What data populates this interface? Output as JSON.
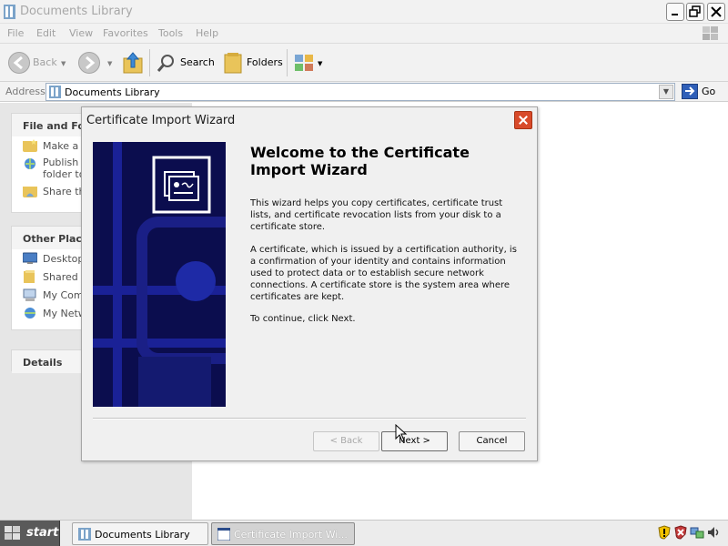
{
  "explorer": {
    "title": "Documents Library",
    "menu": [
      "File",
      "Edit",
      "View",
      "Favorites",
      "Tools",
      "Help"
    ],
    "toolbar": {
      "back": "Back",
      "search": "Search",
      "folders": "Folders"
    },
    "address": {
      "label": "Address",
      "value": "Documents Library",
      "go": "Go"
    },
    "sidebar": {
      "file_tasks": {
        "header": "File and Folder Tasks",
        "items": [
          "Make a new folder",
          "Publish this folder to the Web",
          "Share this folder"
        ]
      },
      "other_places": {
        "header": "Other Places",
        "items": [
          "Desktop",
          "Shared Documents",
          "My Computer",
          "My Network Places"
        ]
      },
      "details": {
        "header": "Details"
      }
    }
  },
  "dialog": {
    "title": "Certificate Import Wizard",
    "heading": "Welcome to the Certificate Import Wizard",
    "paragraphs": [
      "This wizard helps you copy certificates, certificate trust lists, and certificate revocation lists from your disk to a certificate store.",
      "A certificate, which is issued by a certification authority, is a confirmation of your identity and contains information used to protect data or to establish secure network connections. A certificate store is the system area where certificates are kept.",
      "To continue, click Next."
    ],
    "buttons": {
      "back": "< Back",
      "next": "Next >",
      "cancel": "Cancel"
    },
    "banner_color": "#0b0d4e",
    "close_color": "#d84a2a"
  },
  "taskbar": {
    "start": "start",
    "tasks": [
      "Documents Library",
      "Certificate Import Wi..."
    ]
  },
  "icons": [
    "library-icon",
    "search-icon",
    "folders-icon",
    "views-icon",
    "go-arrow-icon",
    "certificate-icon",
    "windows-flag-icon",
    "security-shield-icon",
    "network-icon",
    "volume-icon"
  ]
}
